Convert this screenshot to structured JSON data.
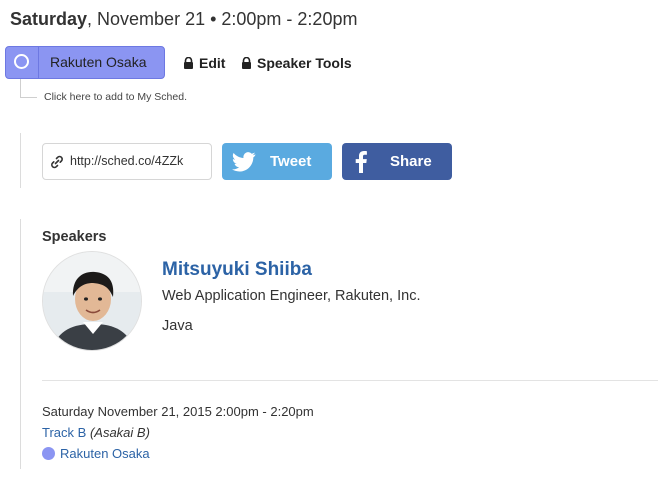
{
  "header": {
    "day": "Saturday",
    "rest": ", November 21 • 2:00pm - 2:20pm"
  },
  "event": {
    "type_label": "Rakuten Osaka",
    "type_color": "#8b95f2",
    "edit_label": "Edit",
    "speaker_tools_label": "Speaker Tools",
    "add_hint": "Click here to add to My Sched."
  },
  "share": {
    "url": "http://sched.co/4ZZk",
    "tweet_label": "Tweet",
    "share_label": "Share",
    "twitter_color": "#5aaae0",
    "facebook_color": "#3f5da0"
  },
  "speakers": {
    "heading": "Speakers",
    "items": [
      {
        "name": "Mitsuyuki Shiiba",
        "title": "Web Application Engineer, Rakuten, Inc.",
        "tag": "Java"
      }
    ]
  },
  "details": {
    "datetime": "Saturday November 21, 2015 2:00pm - 2:20pm",
    "track": "Track B",
    "room": "(Asakai B)",
    "type_label": "Rakuten Osaka"
  }
}
